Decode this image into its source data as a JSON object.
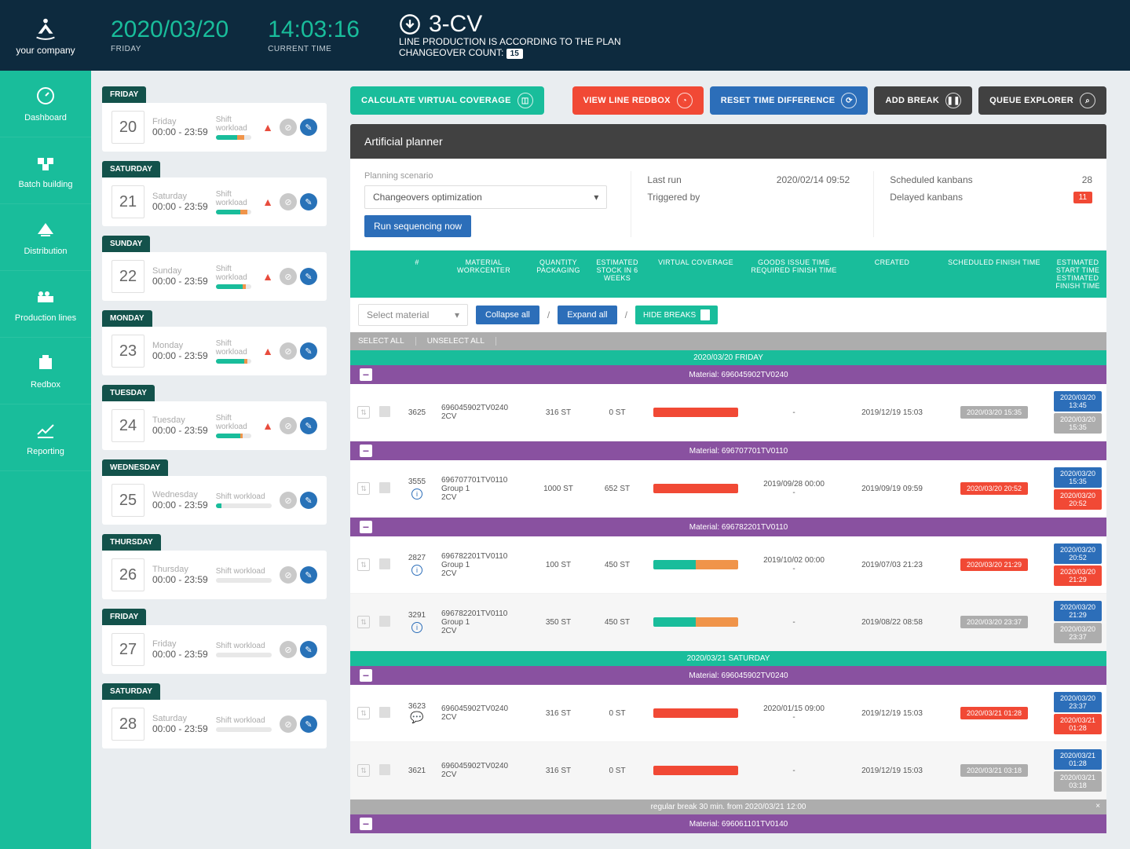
{
  "logo_text": "your company",
  "nav": [
    {
      "label": "Dashboard",
      "icon": "dash"
    },
    {
      "label": "Batch building",
      "icon": "batch"
    },
    {
      "label": "Distribution",
      "icon": "dist"
    },
    {
      "label": "Production lines",
      "icon": "prod"
    },
    {
      "label": "Redbox",
      "icon": "redbox"
    },
    {
      "label": "Reporting",
      "icon": "report"
    }
  ],
  "header": {
    "date": "2020/03/20",
    "date_sub": "FRIDAY",
    "time": "14:03:16",
    "time_sub": "CURRENT TIME",
    "line": "3-CV",
    "line_sub1": "LINE PRODUCTION IS ACCORDING TO THE PLAN",
    "line_sub2": "CHANGEOVER COUNT:",
    "changeover": "15"
  },
  "buttons": {
    "calc": "CALCULATE VIRTUAL COVERAGE",
    "redbox": "VIEW LINE REDBOX",
    "reset": "RESET TIME DIFFERENCE",
    "break": "ADD BREAK",
    "queue": "QUEUE EXPLORER"
  },
  "planner": {
    "title": "Artificial planner",
    "scenario_lbl": "Planning scenario",
    "scenario_val": "Changeovers optimization",
    "run": "Run sequencing now",
    "last_run_lbl": "Last run",
    "last_run_val": "2020/02/14 09:52",
    "trig_lbl": "Triggered by",
    "trig_val": "",
    "sched_lbl": "Scheduled kanbans",
    "sched_val": "28",
    "delay_lbl": "Delayed kanbans",
    "delay_val": "11"
  },
  "days": [
    {
      "tab": "FRIDAY",
      "num": "20",
      "name": "Friday",
      "time": "00:00 - 23:59",
      "g": 60,
      "o": 20,
      "warn": true
    },
    {
      "tab": "SATURDAY",
      "num": "21",
      "name": "Saturday",
      "time": "00:00 - 23:59",
      "g": 70,
      "o": 20,
      "warn": true
    },
    {
      "tab": "SUNDAY",
      "num": "22",
      "name": "Sunday",
      "time": "00:00 - 23:59",
      "g": 75,
      "o": 10,
      "warn": true
    },
    {
      "tab": "MONDAY",
      "num": "23",
      "name": "Monday",
      "time": "00:00 - 23:59",
      "g": 80,
      "o": 10,
      "warn": true
    },
    {
      "tab": "TUESDAY",
      "num": "24",
      "name": "Tuesday",
      "time": "00:00 - 23:59",
      "g": 70,
      "o": 5,
      "warn": true
    },
    {
      "tab": "WEDNESDAY",
      "num": "25",
      "name": "Wednesday",
      "time": "00:00 - 23:59",
      "g": 10,
      "o": 0,
      "warn": false
    },
    {
      "tab": "THURSDAY",
      "num": "26",
      "name": "Thursday",
      "time": "00:00 - 23:59",
      "g": 0,
      "o": 0,
      "warn": false
    },
    {
      "tab": "FRIDAY",
      "num": "27",
      "name": "Friday",
      "time": "00:00 - 23:59",
      "g": 0,
      "o": 0,
      "warn": false
    },
    {
      "tab": "SATURDAY",
      "num": "28",
      "name": "Saturday",
      "time": "00:00 - 23:59",
      "g": 0,
      "o": 0,
      "warn": false
    }
  ],
  "day_workload_lbl": "Shift workload",
  "cols": {
    "num": "#",
    "mat": "MATERIAL WORKCENTER",
    "qty": "QUANTITY PACKAGING",
    "est": "ESTIMATED STOCK IN 6 WEEKS",
    "vc": "VIRTUAL COVERAGE",
    "gi": "GOODS ISSUE TIME REQUIRED FINISH TIME",
    "cr": "CREATED",
    "sf": "SCHEDULED FINISH TIME",
    "ef": "ESTIMATED START TIME ESTIMATED FINISH TIME"
  },
  "filter": {
    "mat": "Select material",
    "collapse": "Collapse all",
    "expand": "Expand all",
    "hide": "HIDE BREAKS",
    "selall": "SELECT ALL",
    "unselall": "UNSELECT ALL"
  },
  "table": [
    {
      "type": "day",
      "text": "2020/03/20 FRIDAY"
    },
    {
      "type": "mat",
      "text": "Material: 696045902TV0240"
    },
    {
      "type": "row",
      "num": "3625",
      "mat": "696045902TV0240",
      "wc": "2CV",
      "qty": "316 ST",
      "est": "0 ST",
      "vc": {
        "r": 100
      },
      "gi1": "",
      "gi2": "-",
      "cr": "2019/12/19 15:03",
      "sf": "2020/03/20 15:35",
      "sf_cls": "gray",
      "t1": "2020/03/20 13:45",
      "t1_cls": "blue",
      "t2": "2020/03/20 15:35",
      "t2_cls": "gray"
    },
    {
      "type": "mat",
      "text": "Material: 696707701TV0110"
    },
    {
      "type": "row",
      "num": "3555",
      "info": true,
      "mat": "696707701TV0110",
      "grp": "Group 1",
      "wc": "2CV",
      "qty": "1000 ST",
      "est": "652 ST",
      "vc": {
        "r": 100
      },
      "gi1": "2019/09/28 00:00",
      "gi2": "-",
      "cr": "2019/09/19 09:59",
      "sf": "2020/03/20 20:52",
      "sf_cls": "red",
      "t1": "2020/03/20 15:35",
      "t1_cls": "blue",
      "t2": "2020/03/20 20:52",
      "t2_cls": "red"
    },
    {
      "type": "mat",
      "text": "Material: 696782201TV0110"
    },
    {
      "type": "row",
      "num": "2827",
      "info": true,
      "mat": "696782201TV0110",
      "grp": "Group 1",
      "wc": "2CV",
      "qty": "100 ST",
      "est": "450 ST",
      "vc": {
        "g": 50,
        "o": 50
      },
      "gi1": "2019/10/02 00:00",
      "gi2": "-",
      "cr": "2019/07/03 21:23",
      "sf": "2020/03/20 21:29",
      "sf_cls": "red",
      "t1": "2020/03/20 20:52",
      "t1_cls": "blue",
      "t2": "2020/03/20 21:29",
      "t2_cls": "red"
    },
    {
      "type": "row",
      "alt": true,
      "num": "3291",
      "info": true,
      "mat": "696782201TV0110",
      "grp": "Group 1",
      "wc": "2CV",
      "qty": "350 ST",
      "est": "450 ST",
      "vc": {
        "g": 50,
        "o": 50
      },
      "gi1": "",
      "gi2": "-",
      "cr": "2019/08/22 08:58",
      "sf": "2020/03/20 23:37",
      "sf_cls": "gray",
      "t1": "2020/03/20 21:29",
      "t1_cls": "blue",
      "t2": "2020/03/20 23:37",
      "t2_cls": "gray"
    },
    {
      "type": "day",
      "text": "2020/03/21 SATURDAY"
    },
    {
      "type": "mat",
      "text": "Material: 696045902TV0240"
    },
    {
      "type": "row",
      "num": "3623",
      "comment": true,
      "mat": "696045902TV0240",
      "wc": "2CV",
      "qty": "316 ST",
      "est": "0 ST",
      "vc": {
        "r": 100
      },
      "gi1": "2020/01/15 09:00",
      "gi2": "-",
      "cr": "2019/12/19 15:03",
      "sf": "2020/03/21 01:28",
      "sf_cls": "red",
      "t1": "2020/03/20 23:37",
      "t1_cls": "blue",
      "t2": "2020/03/21 01:28",
      "t2_cls": "red"
    },
    {
      "type": "row",
      "alt": true,
      "num": "3621",
      "mat": "696045902TV0240",
      "wc": "2CV",
      "qty": "316 ST",
      "est": "0 ST",
      "vc": {
        "r": 100
      },
      "gi1": "",
      "gi2": "-",
      "cr": "2019/12/19 15:03",
      "sf": "2020/03/21 03:18",
      "sf_cls": "gray",
      "t1": "2020/03/21 01:28",
      "t1_cls": "blue",
      "t2": "2020/03/21 03:18",
      "t2_cls": "gray"
    },
    {
      "type": "break",
      "text": "regular break 30 min. from 2020/03/21 12:00"
    },
    {
      "type": "mat",
      "text": "Material: 696061101TV0140"
    }
  ]
}
